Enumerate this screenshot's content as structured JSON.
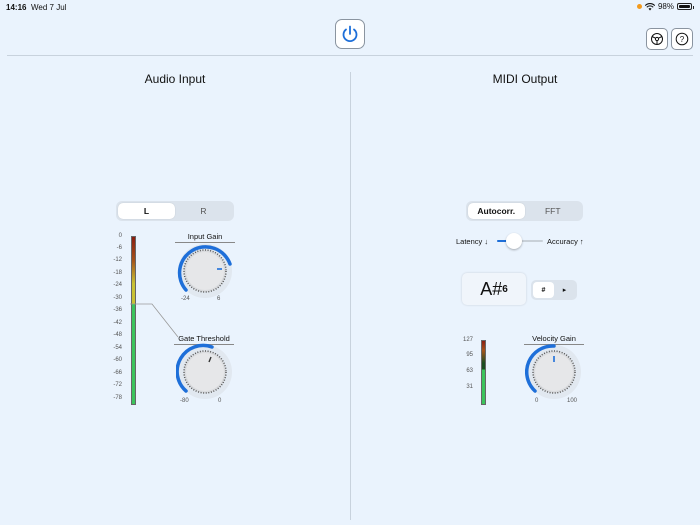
{
  "status": {
    "time": "14:16",
    "date": "Wed 7 Jul",
    "battery": "98%",
    "battery_level": 0.98
  },
  "toolbar": {
    "power_icon": "power-icon",
    "settings_icon": "settings-icon",
    "help_icon": "help-icon"
  },
  "audio_input": {
    "title": "Audio Input",
    "channels": [
      "L",
      "R"
    ],
    "selected_channel": "L",
    "meter_labels": [
      "0",
      "-6",
      "-12",
      "-18",
      "-24",
      "-30",
      "-36",
      "-42",
      "-48",
      "-54",
      "-60",
      "-66",
      "-72",
      "-78"
    ],
    "meter_gate_level": "-30",
    "input_gain": {
      "label": "Input Gain",
      "min": "-24",
      "max": "6"
    },
    "gate_threshold": {
      "label": "Gate Threshold",
      "min": "-80",
      "max": "0"
    }
  },
  "midi_output": {
    "title": "MIDI Output",
    "modes": [
      "Autocorr.",
      "FFT"
    ],
    "selected_mode": "Autocorr.",
    "latency_label": "Latency ↓",
    "accuracy_label": "Accuracy ↑",
    "note_name": "A#",
    "note_octave": "6",
    "sharp_label": "#",
    "play_label": "▸",
    "meter_labels": [
      "127",
      "95",
      "63",
      "31"
    ],
    "velocity_gain": {
      "label": "Velocity Gain",
      "min": "0",
      "max": "100"
    }
  },
  "colors": {
    "accent": "#1e6fd9",
    "meter_green": "#3cc45c",
    "meter_yellow": "#c9c233",
    "meter_red": "#8a1d10"
  }
}
